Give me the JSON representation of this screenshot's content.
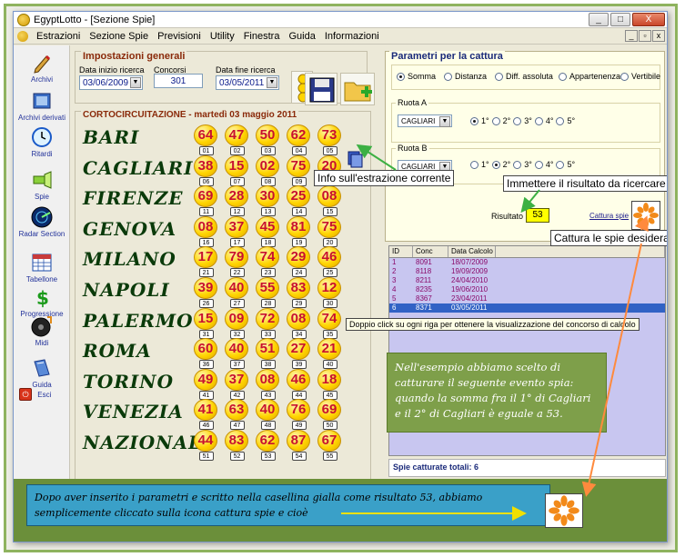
{
  "window": {
    "title": "EgyptLotto - [Sezione Spie]",
    "buttons": {
      "min": "_",
      "max": "□",
      "close": "X"
    }
  },
  "menu": [
    "Estrazioni",
    "Sezione Spie",
    "Previsioni",
    "Utility",
    "Finestra",
    "Guida",
    "Informazioni"
  ],
  "mdi_buttons": {
    "min": "_",
    "restore": "▫",
    "close": "x"
  },
  "toolbar": {
    "items": [
      {
        "label": "Archivi",
        "icon": "pencil-icon"
      },
      {
        "label": "Archivi derivati",
        "icon": "book-icon"
      },
      {
        "label": "Ritardi",
        "icon": "clock-icon"
      },
      {
        "label": "Spie",
        "icon": "flashlight-icon"
      },
      {
        "label": "Radar Section",
        "icon": "radar-icon"
      },
      {
        "label": "Tabellone",
        "icon": "calendar-icon"
      },
      {
        "label": "Progressione",
        "icon": "dollar-icon"
      },
      {
        "label": "Midi",
        "icon": "music-disc-icon"
      },
      {
        "label": "Guida",
        "icon": "help-book-icon"
      },
      {
        "label": "Esci",
        "icon": "exit-icon"
      }
    ]
  },
  "impostazioni": {
    "title": "Impostazioni generali",
    "data_inizio_label": "Data inizio ricerca",
    "data_inizio": "03/06/2009",
    "concorsi_label": "Concorsi",
    "concorsi": "301",
    "data_fine_label": "Data fine ricerca",
    "data_fine": "03/05/2011"
  },
  "cortocircuitazione": {
    "title": "CORTOCIRCUITAZIONE - martedì 03 maggio 2011",
    "wheels": [
      {
        "name": "BARI",
        "numbers": [
          "64",
          "47",
          "50",
          "62",
          "73"
        ],
        "ordinals": [
          "01",
          "02",
          "03",
          "04",
          "05"
        ]
      },
      {
        "name": "CAGLIARI",
        "numbers": [
          "38",
          "15",
          "02",
          "75",
          "20"
        ],
        "ordinals": [
          "06",
          "07",
          "08",
          "09",
          "10"
        ]
      },
      {
        "name": "FIRENZE",
        "numbers": [
          "69",
          "28",
          "30",
          "25",
          "08"
        ],
        "ordinals": [
          "11",
          "12",
          "13",
          "14",
          "15"
        ]
      },
      {
        "name": "GENOVA",
        "numbers": [
          "08",
          "37",
          "45",
          "81",
          "75"
        ],
        "ordinals": [
          "16",
          "17",
          "18",
          "19",
          "20"
        ]
      },
      {
        "name": "MILANO",
        "numbers": [
          "17",
          "79",
          "74",
          "29",
          "46"
        ],
        "ordinals": [
          "21",
          "22",
          "23",
          "24",
          "25"
        ]
      },
      {
        "name": "NAPOLI",
        "numbers": [
          "39",
          "40",
          "55",
          "83",
          "12"
        ],
        "ordinals": [
          "26",
          "27",
          "28",
          "29",
          "30"
        ]
      },
      {
        "name": "PALERMO",
        "numbers": [
          "15",
          "09",
          "72",
          "08",
          "74"
        ],
        "ordinals": [
          "31",
          "32",
          "33",
          "34",
          "35"
        ]
      },
      {
        "name": "ROMA",
        "numbers": [
          "60",
          "40",
          "51",
          "27",
          "21"
        ],
        "ordinals": [
          "36",
          "37",
          "38",
          "39",
          "40"
        ]
      },
      {
        "name": "TORINO",
        "numbers": [
          "49",
          "37",
          "08",
          "46",
          "18"
        ],
        "ordinals": [
          "41",
          "42",
          "43",
          "44",
          "45"
        ]
      },
      {
        "name": "VENEZIA",
        "numbers": [
          "41",
          "63",
          "40",
          "76",
          "69"
        ],
        "ordinals": [
          "46",
          "47",
          "48",
          "49",
          "50"
        ]
      },
      {
        "name": "NAZIONALE",
        "numbers": [
          "44",
          "83",
          "62",
          "87",
          "67"
        ],
        "ordinals": [
          "51",
          "52",
          "53",
          "54",
          "55"
        ]
      }
    ]
  },
  "parametri": {
    "title": "Parametri per la cattura",
    "modes": [
      {
        "label": "Somma",
        "selected": true
      },
      {
        "label": "Distanza",
        "selected": false
      },
      {
        "label": "Diff. assoluta",
        "selected": false
      },
      {
        "label": "Appartenenza",
        "selected": false
      },
      {
        "label": "Vertibile",
        "selected": false
      }
    ],
    "ruota_a_label": "Ruota A",
    "ruota_a": "CAGLIARI",
    "ruota_a_positions": [
      "1°",
      "2°",
      "3°",
      "4°",
      "5°"
    ],
    "ruota_a_selected": 0,
    "ruota_b_label": "Ruota B",
    "ruota_b": "CAGLIARI",
    "ruota_b_positions": [
      "1°",
      "2°",
      "3°",
      "4°",
      "5°"
    ],
    "ruota_b_selected": 1,
    "risultato_label": "Risultato",
    "risultato": "53",
    "cattura_label": "Cattura spie"
  },
  "table": {
    "headers": [
      "ID",
      "Conc",
      "Data Calcolo"
    ],
    "rows": [
      [
        "1",
        "8091",
        "18/07/2009"
      ],
      [
        "2",
        "8118",
        "19/09/2009"
      ],
      [
        "3",
        "8211",
        "24/04/2010"
      ],
      [
        "4",
        "8235",
        "19/06/2010"
      ],
      [
        "5",
        "8367",
        "23/04/2011"
      ],
      [
        "6",
        "8371",
        "03/05/2011"
      ]
    ],
    "selected_row": 5
  },
  "spie_totali": "Spie catturate totali: 6",
  "callouts": {
    "info": "Info sull'estrazione corrente",
    "immettere": "Immettere il risultato da ricercare",
    "cattura": "Cattura le spie desiderate",
    "doppio": "Doppio click su ogni riga per ottenere la visualizzazione del concorso di calcolo"
  },
  "example_note": "Nell'esempio abbiamo scelto di catturare il seguente evento spia: quando la somma fra il 1° di Cagliari e il 2° di Cagliari è eguale a 53.",
  "bottom_note": "Dopo aver inserito i parametri e scritto nella casellina gialla come risultato 53, abbiamo semplicemente cliccato sulla icona cattura spie e cioè",
  "colors": {
    "accent_green": "#7e9f4a",
    "bulb_yellow": "#ffd400",
    "number_red": "#c8102e",
    "selection_blue": "#3162c5",
    "arrow_orange": "#ff8a3d",
    "arrow_green": "#3cb043"
  }
}
